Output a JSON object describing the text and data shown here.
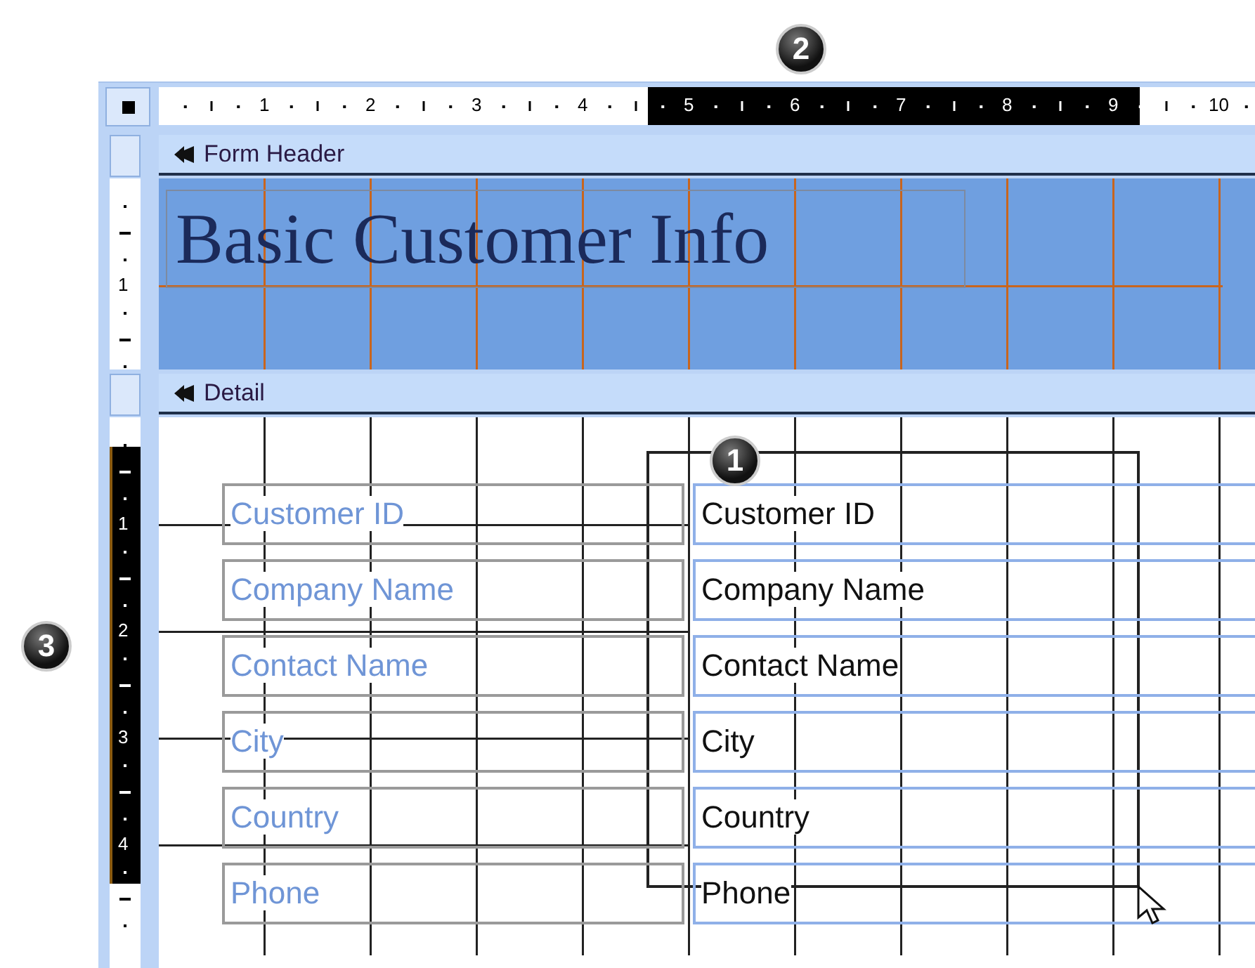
{
  "callouts": [
    "1",
    "2",
    "3"
  ],
  "horizontal_ruler": [
    {
      "label": "1",
      "selected": false
    },
    {
      "label": "2",
      "selected": false
    },
    {
      "label": "3",
      "selected": false
    },
    {
      "label": "4",
      "selected": false
    },
    {
      "label": "5",
      "selected": true
    },
    {
      "label": "6",
      "selected": true
    },
    {
      "label": "7",
      "selected": true
    },
    {
      "label": "8",
      "selected": true
    },
    {
      "label": "9",
      "selected": true
    },
    {
      "label": "10",
      "selected": false
    }
  ],
  "sections": [
    {
      "kind": "header",
      "title": "Form Header",
      "ruler": [
        {
          "label": "1",
          "selected": false
        }
      ],
      "heading": "Basic Customer Info"
    },
    {
      "kind": "detail",
      "title": "Detail",
      "ruler": [
        {
          "label": "1",
          "selected": true
        },
        {
          "label": "2",
          "selected": true
        },
        {
          "label": "3",
          "selected": true
        },
        {
          "label": "4",
          "selected": true
        }
      ],
      "fields": [
        {
          "label": "Customer ID",
          "control": "Customer ID"
        },
        {
          "label": "Company Name",
          "control": "Company Name"
        },
        {
          "label": "Contact Name",
          "control": "Contact Name"
        },
        {
          "label": "City",
          "control": "City"
        },
        {
          "label": "Country",
          "control": "Country"
        },
        {
          "label": "Phone",
          "control": "Phone"
        }
      ]
    }
  ]
}
